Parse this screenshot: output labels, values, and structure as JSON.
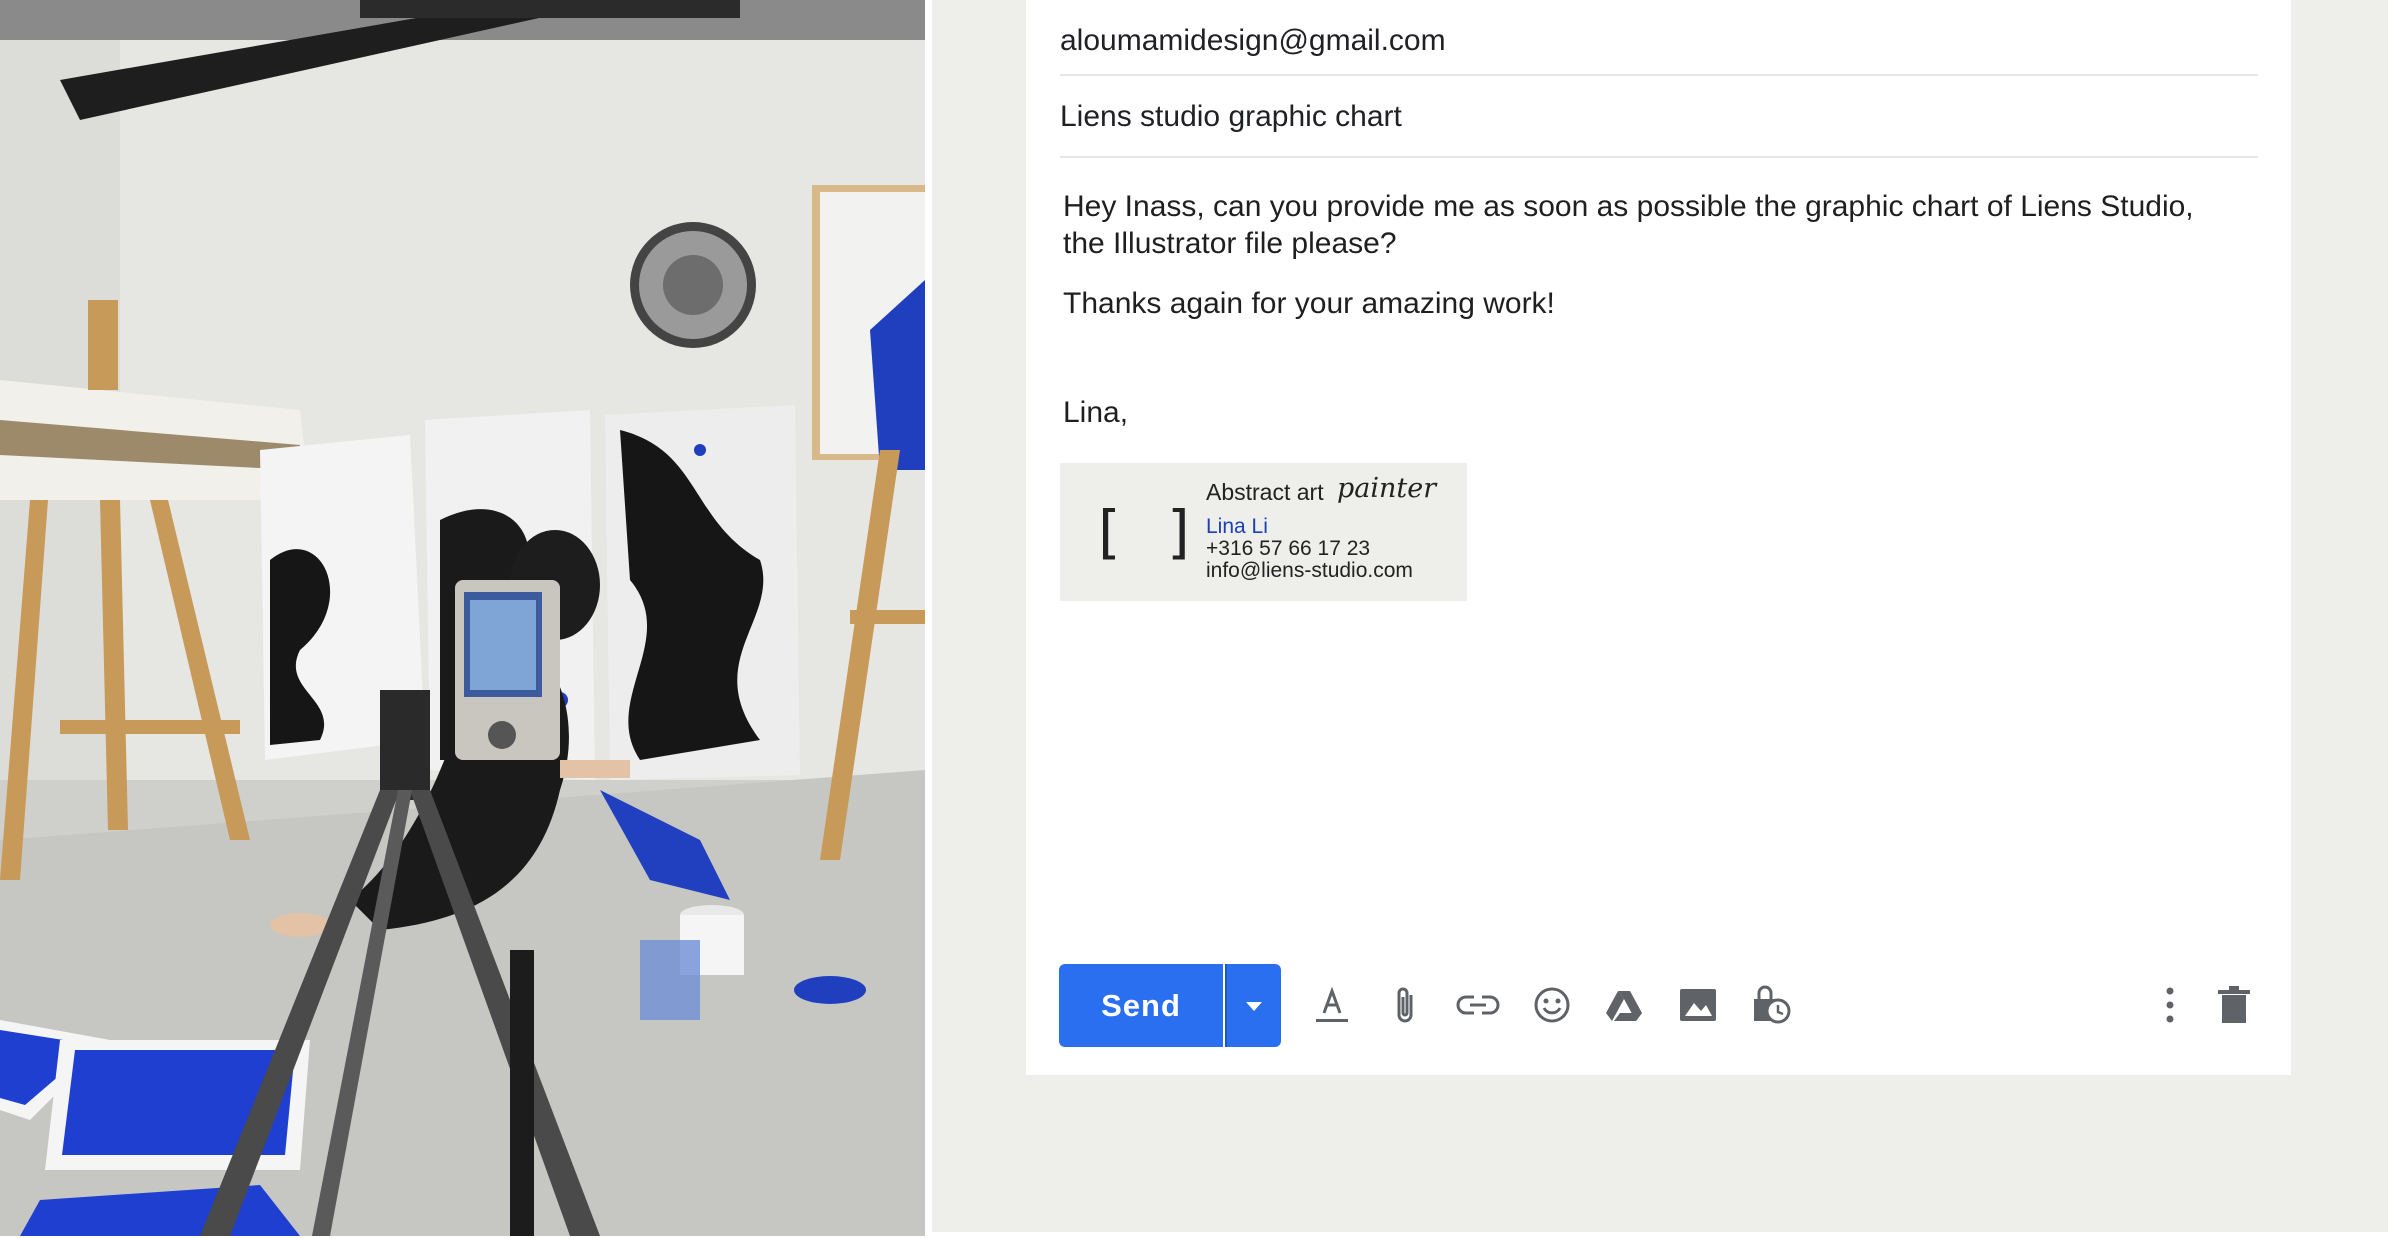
{
  "compose": {
    "to": "aloumamidesign@gmail.com",
    "subject": "Liens studio graphic chart",
    "body_line1": "Hey Inass, can you provide me as soon as possible the graphic chart of Liens Studio,",
    "body_line2": "the Illustrator file please?",
    "body_line3": "Thanks again for your amazing work!",
    "closing": "Lina,"
  },
  "signature": {
    "logo": "[ ]",
    "tagline": "Abstract art",
    "script": "painter",
    "name": "Lina Li",
    "phone": "+316 57 66 17 23",
    "email": "info@liens-studio.com"
  },
  "toolbar": {
    "send_label": "Send",
    "accent": "#2a6ff0",
    "icons": [
      "format-text-icon",
      "attach-icon",
      "link-icon",
      "emoji-icon",
      "drive-icon",
      "photo-icon",
      "schedule-icon",
      "more-options-icon",
      "delete-icon"
    ]
  }
}
